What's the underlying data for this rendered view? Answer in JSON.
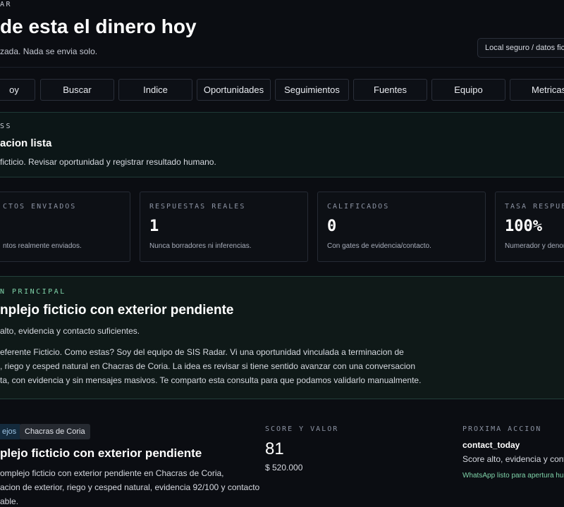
{
  "header": {
    "eyebrow": "AR",
    "title": "de esta el dinero hoy",
    "subtitle": "zada. Nada se envia solo.",
    "mode_pill": "Local seguro / datos ficti"
  },
  "tabs": [
    "oy",
    "Buscar",
    "Indice",
    "Oportunidades",
    "Seguimientos",
    "Fuentes",
    "Equipo",
    "Metricas"
  ],
  "status": {
    "eyebrow": "SS",
    "title": "acion lista",
    "text": "ficticio. Revisar oportunidad y registrar resultado humano."
  },
  "kpis": [
    {
      "label": "CTOS ENVIADOS",
      "value": "",
      "note": "ntos realmente enviados."
    },
    {
      "label": "RESPUESTAS REALES",
      "value": "1",
      "note": "Nunca borradores ni inferencias."
    },
    {
      "label": "CALIFICADOS",
      "value": "0",
      "note": "Con gates de evidencia/contacto."
    },
    {
      "label": "TASA RESPUES",
      "value": "100%",
      "note": "Numerador y denor"
    }
  ],
  "main_action": {
    "eyebrow": "N PRINCIPAL",
    "title": "nplejo ficticio con exterior pendiente",
    "reason": "alto, evidencia y contacto suficientes.",
    "message_lines": [
      "eferente Ficticio. Como estas? Soy del equipo de SIS Radar. Vi una oportunidad vinculada a terminacion de",
      ", riego y cesped natural en Chacras de Coria. La idea es revisar si tiene sentido avanzar con una conversacion",
      "ta, con evidencia y sin mensajes masivos. Te comparto esta consulta para que podamos validarlo manualmente."
    ]
  },
  "opportunity": {
    "tags": [
      "ejos",
      "Chacras de Coria"
    ],
    "title": "plejo ficticio con exterior pendiente",
    "description_lines": [
      "omplejo ficticio con exterior pendiente en Chacras de Coria,",
      "acion de exterior, riego y cesped natural, evidencia 92/100 y contacto",
      "able."
    ],
    "score_label": "SCORE Y VALOR",
    "score": "81",
    "value": "$ 520.000",
    "next_label": "PROXIMA ACCION",
    "next_action": "contact_today",
    "next_reason": "Score alto, evidencia y conta",
    "next_note": "WhatsApp listo para apertura hu"
  }
}
